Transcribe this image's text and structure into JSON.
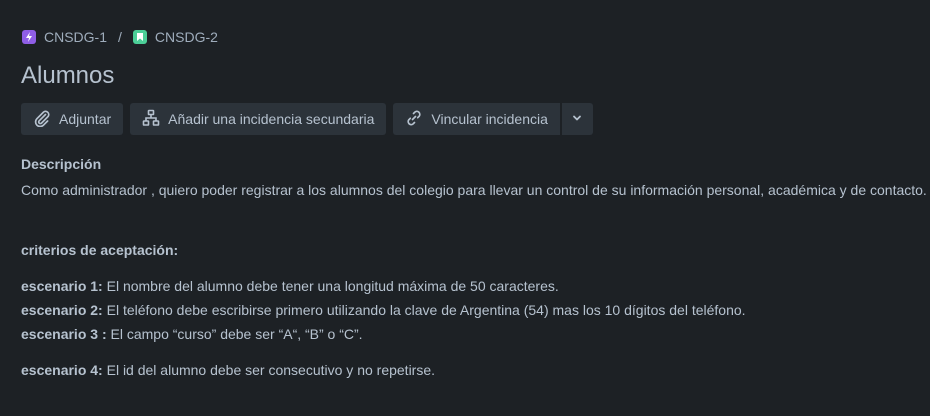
{
  "breadcrumb": {
    "items": [
      {
        "label": "CNSDG-1",
        "icon": "epic-icon",
        "color": "#8f5ee6"
      },
      {
        "label": "CNSDG-2",
        "icon": "story-icon",
        "color": "#4bce97"
      }
    ],
    "separator": "/"
  },
  "issue": {
    "title": "Alumnos"
  },
  "toolbar": {
    "attach_label": "Adjuntar",
    "child_label": "Añadir una incidencia secundaria",
    "link_label": "Vincular incidencia"
  },
  "description": {
    "heading": "Descripción",
    "text": "Como administrador , quiero poder registrar a los alumnos del colegio para llevar un control de su información personal, académica y de contacto.",
    "criteria_heading": "criterios de aceptación:",
    "scenarios": [
      {
        "label": "escenario 1:",
        "text": " El nombre del alumno debe tener una longitud máxima de 50 caracteres."
      },
      {
        "label": "escenario 2:",
        "text": " El teléfono debe escribirse primero utilizando la clave de Argentina (54) mas los 10 dígitos del teléfono."
      },
      {
        "label": "escenario 3 :",
        "text": " El campo “curso” debe ser “A“, “B” o “C”."
      },
      {
        "label": "escenario 4:",
        "text": " El id del alumno debe ser consecutivo y no repetirse."
      }
    ]
  }
}
